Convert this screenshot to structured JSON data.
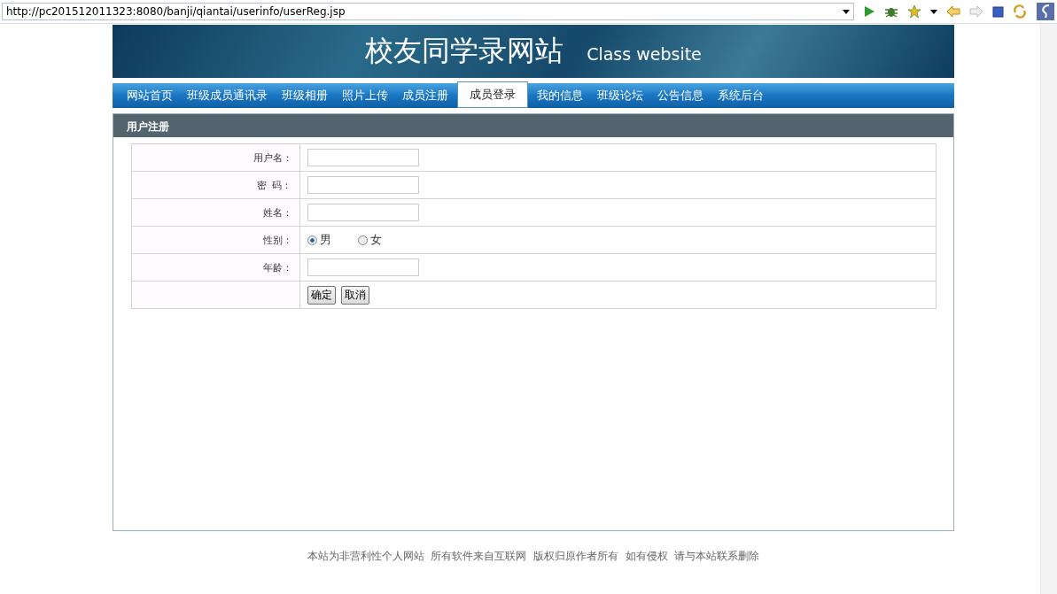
{
  "address_bar": {
    "url": "http://pc201512011323:8080/banji/qiantai/userinfo/userReg.jsp"
  },
  "banner": {
    "title": "校友同学录网站",
    "subtitle": "Class website"
  },
  "nav": [
    {
      "label": "网站首页",
      "selected": false
    },
    {
      "label": "班级成员通讯录",
      "selected": false
    },
    {
      "label": "班级相册",
      "selected": false
    },
    {
      "label": "照片上传",
      "selected": false
    },
    {
      "label": "成员注册",
      "selected": false
    },
    {
      "label": "成员登录",
      "selected": true
    },
    {
      "label": "我的信息",
      "selected": false
    },
    {
      "label": "班级论坛",
      "selected": false
    },
    {
      "label": "公告信息",
      "selected": false
    },
    {
      "label": "系统后台",
      "selected": false
    }
  ],
  "panel": {
    "title": "用户注册",
    "rows": [
      {
        "kind": "input",
        "label": "用户名："
      },
      {
        "kind": "input",
        "label": "密  码："
      },
      {
        "kind": "input",
        "label": "姓名："
      },
      {
        "kind": "radio",
        "label": "性别：",
        "options": [
          {
            "label": "男",
            "selected": true
          },
          {
            "label": "女",
            "selected": false
          }
        ]
      },
      {
        "kind": "input",
        "label": "年龄："
      },
      {
        "kind": "buttons",
        "buttons": [
          "确定",
          "取消"
        ]
      }
    ]
  },
  "footer": "本站为非营利性个人网站  所有软件来自互联网  版权归原作者所有  如有侵权  请与本站联系删除"
}
